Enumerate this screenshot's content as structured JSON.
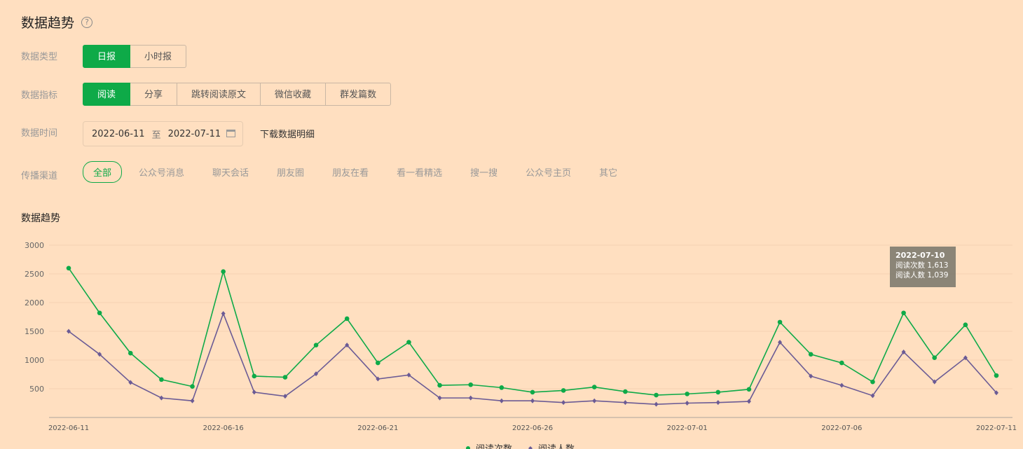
{
  "header": {
    "title": "数据趋势",
    "help_icon": "question-circle-icon"
  },
  "filters": {
    "type_label": "数据类型",
    "type_options": [
      "日报",
      "小时报"
    ],
    "metric_label": "数据指标",
    "metric_options": [
      "阅读",
      "分享",
      "跳转阅读原文",
      "微信收藏",
      "群发篇数"
    ],
    "time_label": "数据时间",
    "date_start": "2022-06-11",
    "date_sep": "至",
    "date_end": "2022-07-11",
    "download_label": "下载数据明细",
    "channel_label": "传播渠道",
    "channel_options": [
      "全部",
      "公众号消息",
      "聊天会话",
      "朋友圈",
      "朋友在看",
      "看一看精选",
      "搜一搜",
      "公众号主页",
      "其它"
    ]
  },
  "chart_title": "数据趋势",
  "tooltip": {
    "date": "2022-07-10",
    "line1": "阅读次数 1,613",
    "line2": "阅读人数 1,039"
  },
  "colors": {
    "accent": "#0eaa48",
    "series1": "#0eaa48",
    "series2": "#6b5b95"
  },
  "chart_data": {
    "type": "line",
    "x": [
      "2022-06-11",
      "2022-06-12",
      "2022-06-13",
      "2022-06-14",
      "2022-06-15",
      "2022-06-16",
      "2022-06-17",
      "2022-06-18",
      "2022-06-19",
      "2022-06-20",
      "2022-06-21",
      "2022-06-22",
      "2022-06-23",
      "2022-06-24",
      "2022-06-25",
      "2022-06-26",
      "2022-06-27",
      "2022-06-28",
      "2022-06-29",
      "2022-06-30",
      "2022-07-01",
      "2022-07-02",
      "2022-07-03",
      "2022-07-04",
      "2022-07-05",
      "2022-07-06",
      "2022-07-07",
      "2022-07-08",
      "2022-07-09",
      "2022-07-10",
      "2022-07-11"
    ],
    "x_ticks": [
      "2022-06-11",
      "2022-06-16",
      "2022-06-21",
      "2022-06-26",
      "2022-07-01",
      "2022-07-06",
      "2022-07-11"
    ],
    "y_ticks": [
      500,
      1000,
      1500,
      2000,
      2500,
      3000
    ],
    "ylim": [
      0,
      3000
    ],
    "grid": true,
    "legend_position": "bottom",
    "series": [
      {
        "name": "阅读次数",
        "values": [
          2600,
          1820,
          1120,
          660,
          540,
          2540,
          720,
          700,
          1260,
          1720,
          950,
          1310,
          560,
          570,
          520,
          440,
          470,
          530,
          450,
          390,
          410,
          440,
          490,
          1660,
          1100,
          950,
          620,
          1820,
          1040,
          1613,
          730
        ]
      },
      {
        "name": "阅读人数",
        "values": [
          1500,
          1100,
          610,
          340,
          290,
          1810,
          440,
          370,
          760,
          1260,
          670,
          740,
          340,
          340,
          290,
          290,
          260,
          290,
          260,
          230,
          250,
          260,
          280,
          1310,
          720,
          560,
          380,
          1140,
          620,
          1039,
          430
        ]
      }
    ]
  }
}
